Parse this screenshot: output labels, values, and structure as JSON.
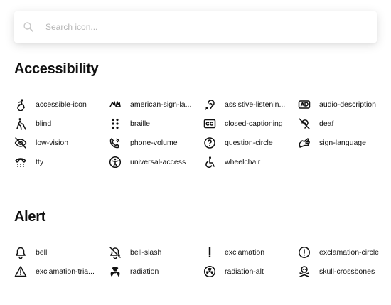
{
  "search": {
    "placeholder": "Search icon..."
  },
  "sections": [
    {
      "title": "Accessibility",
      "items": [
        {
          "label": "accessible-icon",
          "icon": "accessible-icon"
        },
        {
          "label": "american-sign-la...",
          "icon": "american-sign-language-icon"
        },
        {
          "label": "assistive-listenin...",
          "icon": "assistive-listening-icon"
        },
        {
          "label": "audio-description",
          "icon": "audio-description-icon"
        },
        {
          "label": "blind",
          "icon": "blind-icon"
        },
        {
          "label": "braille",
          "icon": "braille-icon"
        },
        {
          "label": "closed-captioning",
          "icon": "closed-captioning-icon"
        },
        {
          "label": "deaf",
          "icon": "deaf-icon"
        },
        {
          "label": "low-vision",
          "icon": "low-vision-icon"
        },
        {
          "label": "phone-volume",
          "icon": "phone-volume-icon"
        },
        {
          "label": "question-circle",
          "icon": "question-circle-icon"
        },
        {
          "label": "sign-language",
          "icon": "sign-language-icon"
        },
        {
          "label": "tty",
          "icon": "tty-icon"
        },
        {
          "label": "universal-access",
          "icon": "universal-access-icon"
        },
        {
          "label": "wheelchair",
          "icon": "wheelchair-icon"
        }
      ]
    },
    {
      "title": "Alert",
      "items": [
        {
          "label": "bell",
          "icon": "bell-icon"
        },
        {
          "label": "bell-slash",
          "icon": "bell-slash-icon"
        },
        {
          "label": "exclamation",
          "icon": "exclamation-icon"
        },
        {
          "label": "exclamation-circle",
          "icon": "exclamation-circle-icon"
        },
        {
          "label": "exclamation-tria...",
          "icon": "exclamation-triangle-icon"
        },
        {
          "label": "radiation",
          "icon": "radiation-icon"
        },
        {
          "label": "radiation-alt",
          "icon": "radiation-alt-icon"
        },
        {
          "label": "skull-crossbones",
          "icon": "skull-crossbones-icon"
        }
      ]
    }
  ]
}
